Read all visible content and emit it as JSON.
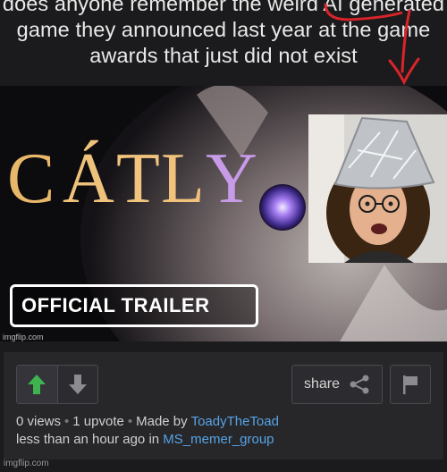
{
  "caption": {
    "text": "does anyone remember the weird AI generated game they announced last year at the game awards that just did not exist"
  },
  "meme": {
    "logo_text": "CÁTLY",
    "trailer_label": "OFFICIAL TRAILER",
    "watermark": "imgflip.com"
  },
  "footer": {
    "share_label": "share",
    "views": "0 views",
    "upvotes": "1 upvote",
    "made_by_label": "Made by",
    "author": "ToadyTheToad",
    "time_label": "less than an hour ago in",
    "stream": "MS_memer_group",
    "watermark": "imgflip.com"
  },
  "colors": {
    "upvote": "#3fb34f",
    "link": "#56a3e6",
    "annotation": "#d9242a"
  },
  "icons": [
    "upvote-arrow-icon",
    "downvote-arrow-icon",
    "share-icon",
    "flag-icon"
  ]
}
